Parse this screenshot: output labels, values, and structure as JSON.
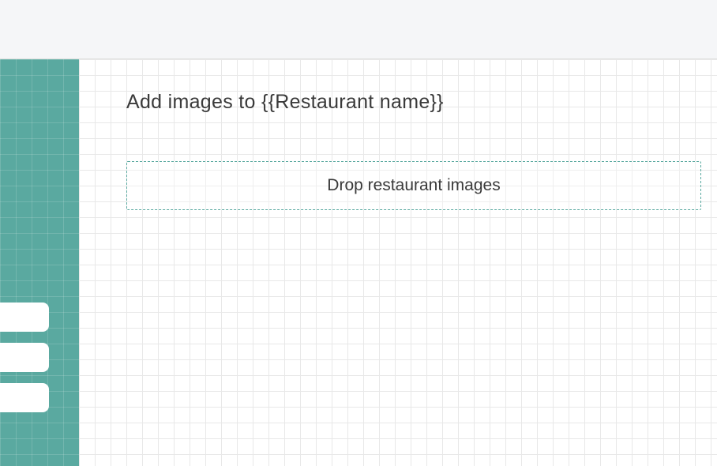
{
  "header": {
    "title": "Add images to {{Restaurant name}}"
  },
  "dropzone": {
    "label": "Drop restaurant images"
  }
}
